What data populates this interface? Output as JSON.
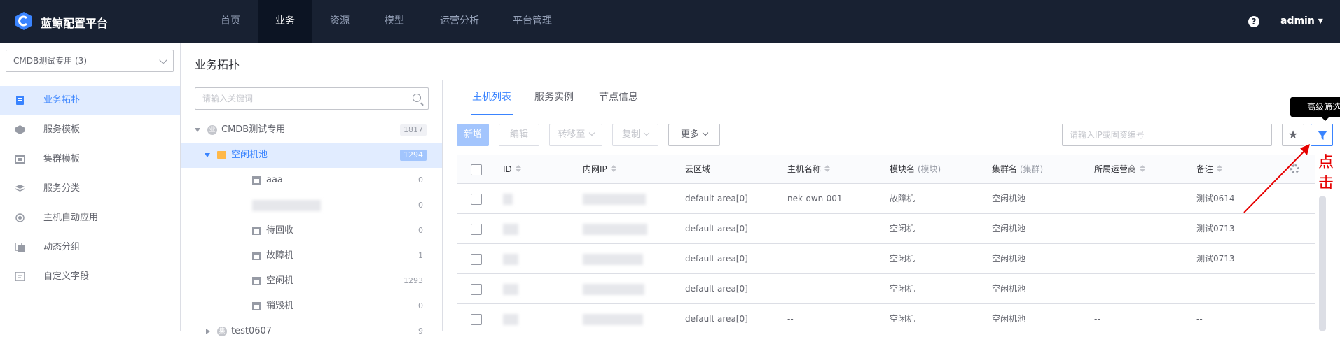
{
  "app": {
    "brand": "蓝鲸配置平台",
    "user": "admin"
  },
  "nav": [
    "首页",
    "业务",
    "资源",
    "模型",
    "运营分析",
    "平台管理"
  ],
  "biz_select": "CMDB测试专用 (3)",
  "sidebar": [
    "业务拓扑",
    "服务模板",
    "集群模板",
    "服务分类",
    "主机自动应用",
    "动态分组",
    "自定义字段"
  ],
  "page_title": "业务拓扑",
  "tree": {
    "search_placeholder": "请输入关键词",
    "root": {
      "label": "CMDB测试专用",
      "count": "1817"
    },
    "pool": {
      "label": "空闲机池",
      "count": "1294"
    },
    "modules": [
      {
        "label": "aaa",
        "count": "0"
      },
      {
        "label": "",
        "count": "0"
      },
      {
        "label": "待回收",
        "count": "0"
      },
      {
        "label": "故障机",
        "count": "1"
      },
      {
        "label": "空闲机",
        "count": "1293"
      },
      {
        "label": "销毁机",
        "count": "0"
      }
    ],
    "next": {
      "label": "test0607",
      "count": "9"
    }
  },
  "tabs": [
    "主机列表",
    "服务实例",
    "节点信息"
  ],
  "toolbar": {
    "new": "新增",
    "edit": "编辑",
    "move": "转移至",
    "copy": "复制",
    "more": "更多",
    "ip_placeholder": "请输入IP或固资编号",
    "tooltip": "高级筛选"
  },
  "table": {
    "headers": [
      "ID",
      "内网IP",
      "云区域",
      "主机名称",
      "模块名",
      "集群名",
      "所属运营商",
      "备注"
    ],
    "header_sub": {
      "module": "(模块)",
      "cluster": "(集群)"
    },
    "rows": [
      {
        "cloud": "default area[0]",
        "host": "nek-own-001",
        "module": "故障机",
        "cluster": "空闲机池",
        "isp": "--",
        "note": "测试0614"
      },
      {
        "cloud": "default area[0]",
        "host": "--",
        "module": "空闲机",
        "cluster": "空闲机池",
        "isp": "--",
        "note": "测试0713"
      },
      {
        "cloud": "default area[0]",
        "host": "--",
        "module": "空闲机",
        "cluster": "空闲机池",
        "isp": "--",
        "note": "测试0713"
      },
      {
        "cloud": "default area[0]",
        "host": "--",
        "module": "空闲机",
        "cluster": "空闲机池",
        "isp": "--",
        "note": "--"
      },
      {
        "cloud": "default area[0]",
        "host": "--",
        "module": "空闲机",
        "cluster": "空闲机池",
        "isp": "--",
        "note": "--"
      }
    ]
  },
  "annotation": "点击",
  "colors": {
    "primary": "#3a84ff",
    "nav_bg": "#182132",
    "annotation": "#e60000"
  }
}
